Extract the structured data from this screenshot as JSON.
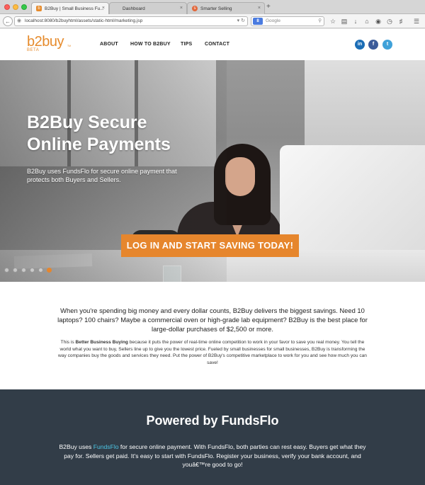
{
  "browser": {
    "tabs": [
      {
        "title": "B2Buy | Small Business Fu...",
        "active": true,
        "favicon": "b"
      },
      {
        "title": "Dashboard",
        "active": false,
        "favicon": ""
      },
      {
        "title": "Smarter Selling",
        "active": false,
        "favicon": "s"
      }
    ],
    "tab_close_glyph": "×",
    "new_tab_glyph": "+",
    "url": "localhost:8080/b2buyhtml/assets/static-html/marketing.jsp",
    "search_placeholder": "Google",
    "search_engine_badge": "8",
    "icons": [
      "back-icon",
      "globe-icon",
      "reload-icon",
      "bookmark-star-icon",
      "reading-list-icon",
      "download-icon",
      "home-icon",
      "pocket-icon",
      "history-icon",
      "extension-icon",
      "menu-icon"
    ]
  },
  "site": {
    "logo_text": "b2buy",
    "logo_tm": "TM",
    "logo_badge": "BETA",
    "nav": [
      "ABOUT",
      "HOW TO B2BUY",
      "TIPS",
      "CONTACT"
    ],
    "social": [
      {
        "name": "linkedin",
        "glyph": "in"
      },
      {
        "name": "facebook",
        "glyph": "f"
      },
      {
        "name": "twitter",
        "glyph": "t"
      }
    ]
  },
  "hero": {
    "title": "B2Buy Secure Online Payments",
    "text": "B2Buy uses FundsFlo for secure online payment that protects both Buyers and Sellers.",
    "cta_label": "LOG IN AND START SAVING TODAY!",
    "slides_count": 6,
    "active_slide": 6
  },
  "intro": {
    "lead": "When you're spending big money and every dollar counts, B2Buy delivers the biggest savings. Need 10 laptops? 100 chairs? Maybe a commercial oven or high-grade lab equipment? B2Buy is the best place for large-dollar purchases of $2,500 or more.",
    "body_prefix": "This is ",
    "body_bold": "Better Business Buying",
    "body_suffix": " because it puts the power of real-time online competition to work in your favor to save you real money. You tell the world what you want to buy, Sellers line up to give you the lowest price. Fueled by small businesses for small businesses, B2Buy is transforming the way companies buy the goods and services they need. Put the power of B2Buy's competitive marketplace to work for you and see how much you can save!"
  },
  "powered": {
    "title": "Powered by FundsFlo",
    "text_prefix": "B2Buy uses ",
    "text_link": "FundsFlo",
    "text_suffix": " for secure online payment. With FundsFlo, both parties can rest easy. Buyers get what they pay for. Sellers get paid. It's easy to start with FundsFlo. Register your business, verify your bank account, and youâ€™re good to go!"
  },
  "colors": {
    "brand_orange": "#e68b2c",
    "dark_section": "#323d48",
    "link_cyan": "#4cc5e4",
    "linkedin": "#1b6db6",
    "facebook": "#3b5b9a",
    "twitter": "#3fa1d9"
  }
}
